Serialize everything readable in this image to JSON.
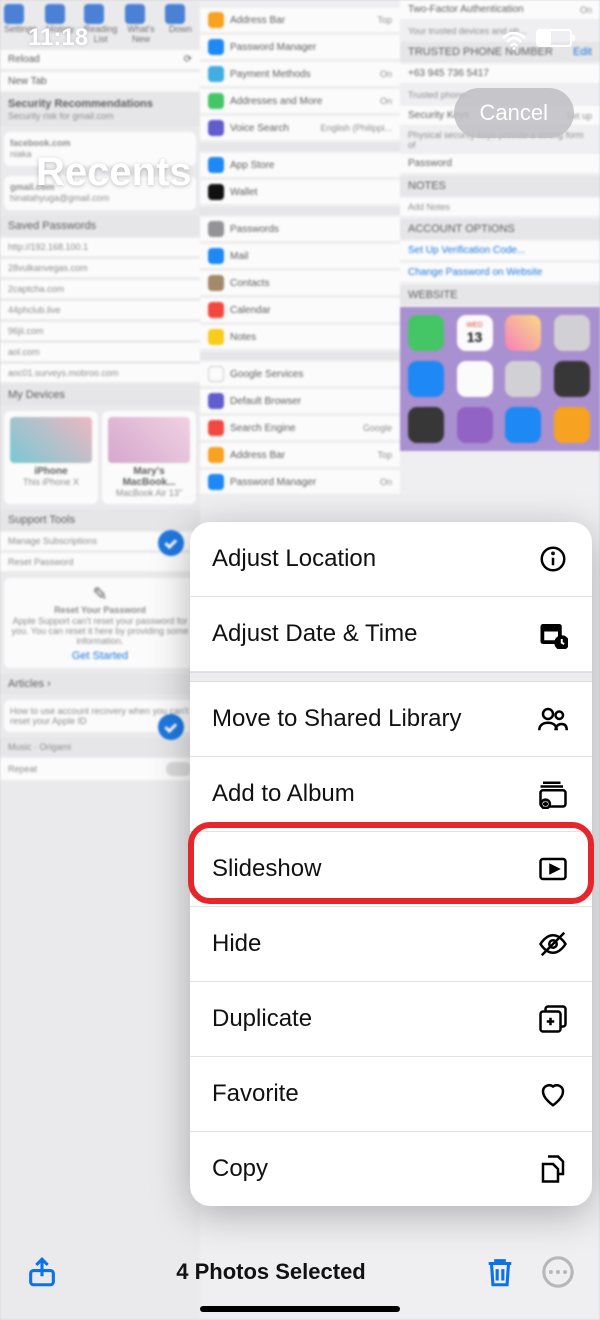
{
  "status": {
    "time": "11:18"
  },
  "header": {
    "title": "Recents",
    "cancel": "Cancel"
  },
  "action_sheet": {
    "items": [
      {
        "label": "Adjust Location",
        "icon": "info-icon"
      },
      {
        "label": "Adjust Date & Time",
        "icon": "calendar-clock-icon"
      },
      {
        "label": "Move to Shared Library",
        "icon": "people-icon"
      },
      {
        "label": "Add to Album",
        "icon": "album-add-icon"
      },
      {
        "label": "Slideshow",
        "icon": "play-rect-icon",
        "highlighted": true
      },
      {
        "label": "Hide",
        "icon": "eye-slash-icon"
      },
      {
        "label": "Duplicate",
        "icon": "plus-square-icon"
      },
      {
        "label": "Favorite",
        "icon": "heart-icon"
      },
      {
        "label": "Copy",
        "icon": "doc-doc-icon"
      }
    ]
  },
  "toolbar": {
    "selected_text": "4 Photos Selected"
  },
  "bg": {
    "colA": {
      "tabs": [
        "Settings",
        "History",
        "Reading List",
        "What's New",
        "Down"
      ],
      "reload": "Reload",
      "new_tab": "New Tab",
      "sec_rec": "Security Recommendations",
      "sec_sub": "Security risk for gmail.com",
      "accounts": [
        {
          "site": "facebook.com",
          "user": "niaka"
        },
        {
          "site": "gmail.com",
          "user": "hinatahyuga@gmail.com"
        }
      ],
      "saved_hdr": "Saved Passwords",
      "saved": [
        "http://192.168.100.1",
        "28vulkanvegas.com",
        "2captcha.com",
        "44phclub.live",
        "96jii.com",
        "aol.com",
        "aoc01.surveys.mobroo.com"
      ],
      "devices_hdr": "My Devices",
      "devices": [
        {
          "name": "iPhone",
          "sub": "This iPhone X"
        },
        {
          "name": "Mary's MacBook...",
          "sub": "MacBook Air 13\""
        }
      ],
      "support_hdr": "Support Tools",
      "support": [
        "Manage Subscriptions",
        "Reset Password"
      ],
      "reset_title": "Reset Your Password",
      "reset_body": "Apple Support can't reset your password for you. You can reset it here by providing some information.",
      "get_started": "Get Started",
      "articles_hdr": "Articles",
      "article": "How to use account recovery when you can't reset your Apple ID",
      "music_hdr": "Music",
      "repeat": "Repeat",
      "origami": "Origami"
    },
    "colB": {
      "rows1": [
        {
          "label": "Address Bar",
          "right": "Top"
        },
        {
          "label": "Password Manager",
          "right": ""
        },
        {
          "label": "Payment Methods",
          "right": "On"
        },
        {
          "label": "Addresses and More",
          "right": "On"
        },
        {
          "label": "Voice Search",
          "right": "English (Philippi..."
        }
      ],
      "rows2": [
        {
          "label": "App Store"
        },
        {
          "label": "Wallet"
        }
      ],
      "rows3": [
        {
          "label": "Passwords"
        },
        {
          "label": "Mail"
        },
        {
          "label": "Contacts"
        },
        {
          "label": "Calendar"
        },
        {
          "label": "Notes"
        }
      ],
      "rows4": [
        {
          "label": "Google Services"
        },
        {
          "label": "Default Browser"
        },
        {
          "label": "Search Engine",
          "right": "Google"
        },
        {
          "label": "Address Bar",
          "right": "Top"
        },
        {
          "label": "Password Manager",
          "right": "On"
        }
      ]
    },
    "colC": {
      "tfa": "Two-Factor Authentication",
      "tfa_state": "On",
      "trusted_lbl": "TRUSTED PHONE NUMBER",
      "edit": "Edit",
      "phone": "+63 945 736 5417",
      "sec_keys": "Security Keys",
      "setup": "Set up",
      "sec_keys_sub": "Physical security keys provide a strong form of",
      "password": "Password",
      "notes": "NOTES",
      "add_notes": "Add Notes",
      "acct_opts": "ACCOUNT OPTIONS",
      "verif": "Set Up Verification Code...",
      "change": "Change Password on Website",
      "website": "WEBSITE",
      "apps": [
        "FaceTime",
        "Calendar",
        "Photos",
        "Camera",
        "Mail",
        "Notes",
        "Reminders",
        "Clock",
        "TV",
        "Podcasts",
        "App Store",
        "Maps"
      ],
      "wed": "WED",
      "day": "13"
    }
  }
}
